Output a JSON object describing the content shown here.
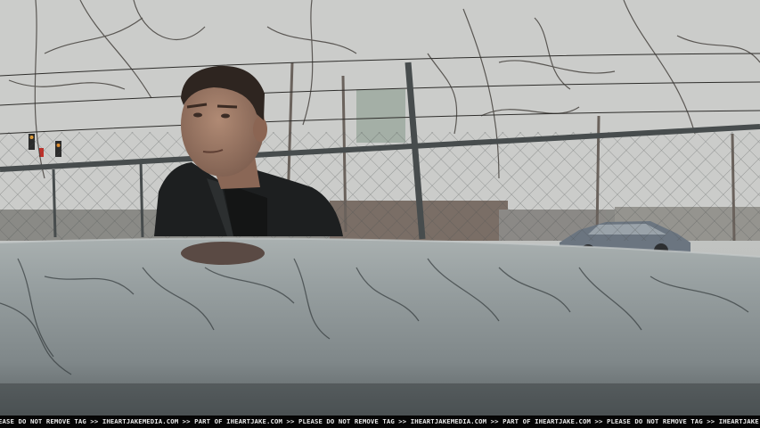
{
  "image": {
    "description_hidden": "",
    "watermark_text": "EASE DO NOT REMOVE TAG >> IHEARTJAKEMEDIA.COM >> PART OF IHEARTJAKE.COM >> PLEASE DO NOT REMOVE TAG >> IHEARTJAKEMEDIA.COM >> PART OF IHEARTJAKE.COM >> PLEASE DO NOT REMOVE TAG >> IHEARTJAKE"
  },
  "colors": {
    "sky": "#c9cac8",
    "car_roof": "#8d9596",
    "jacket": "#1c1e1f",
    "skin": "#9e7a66",
    "fence": "#4b5050"
  }
}
